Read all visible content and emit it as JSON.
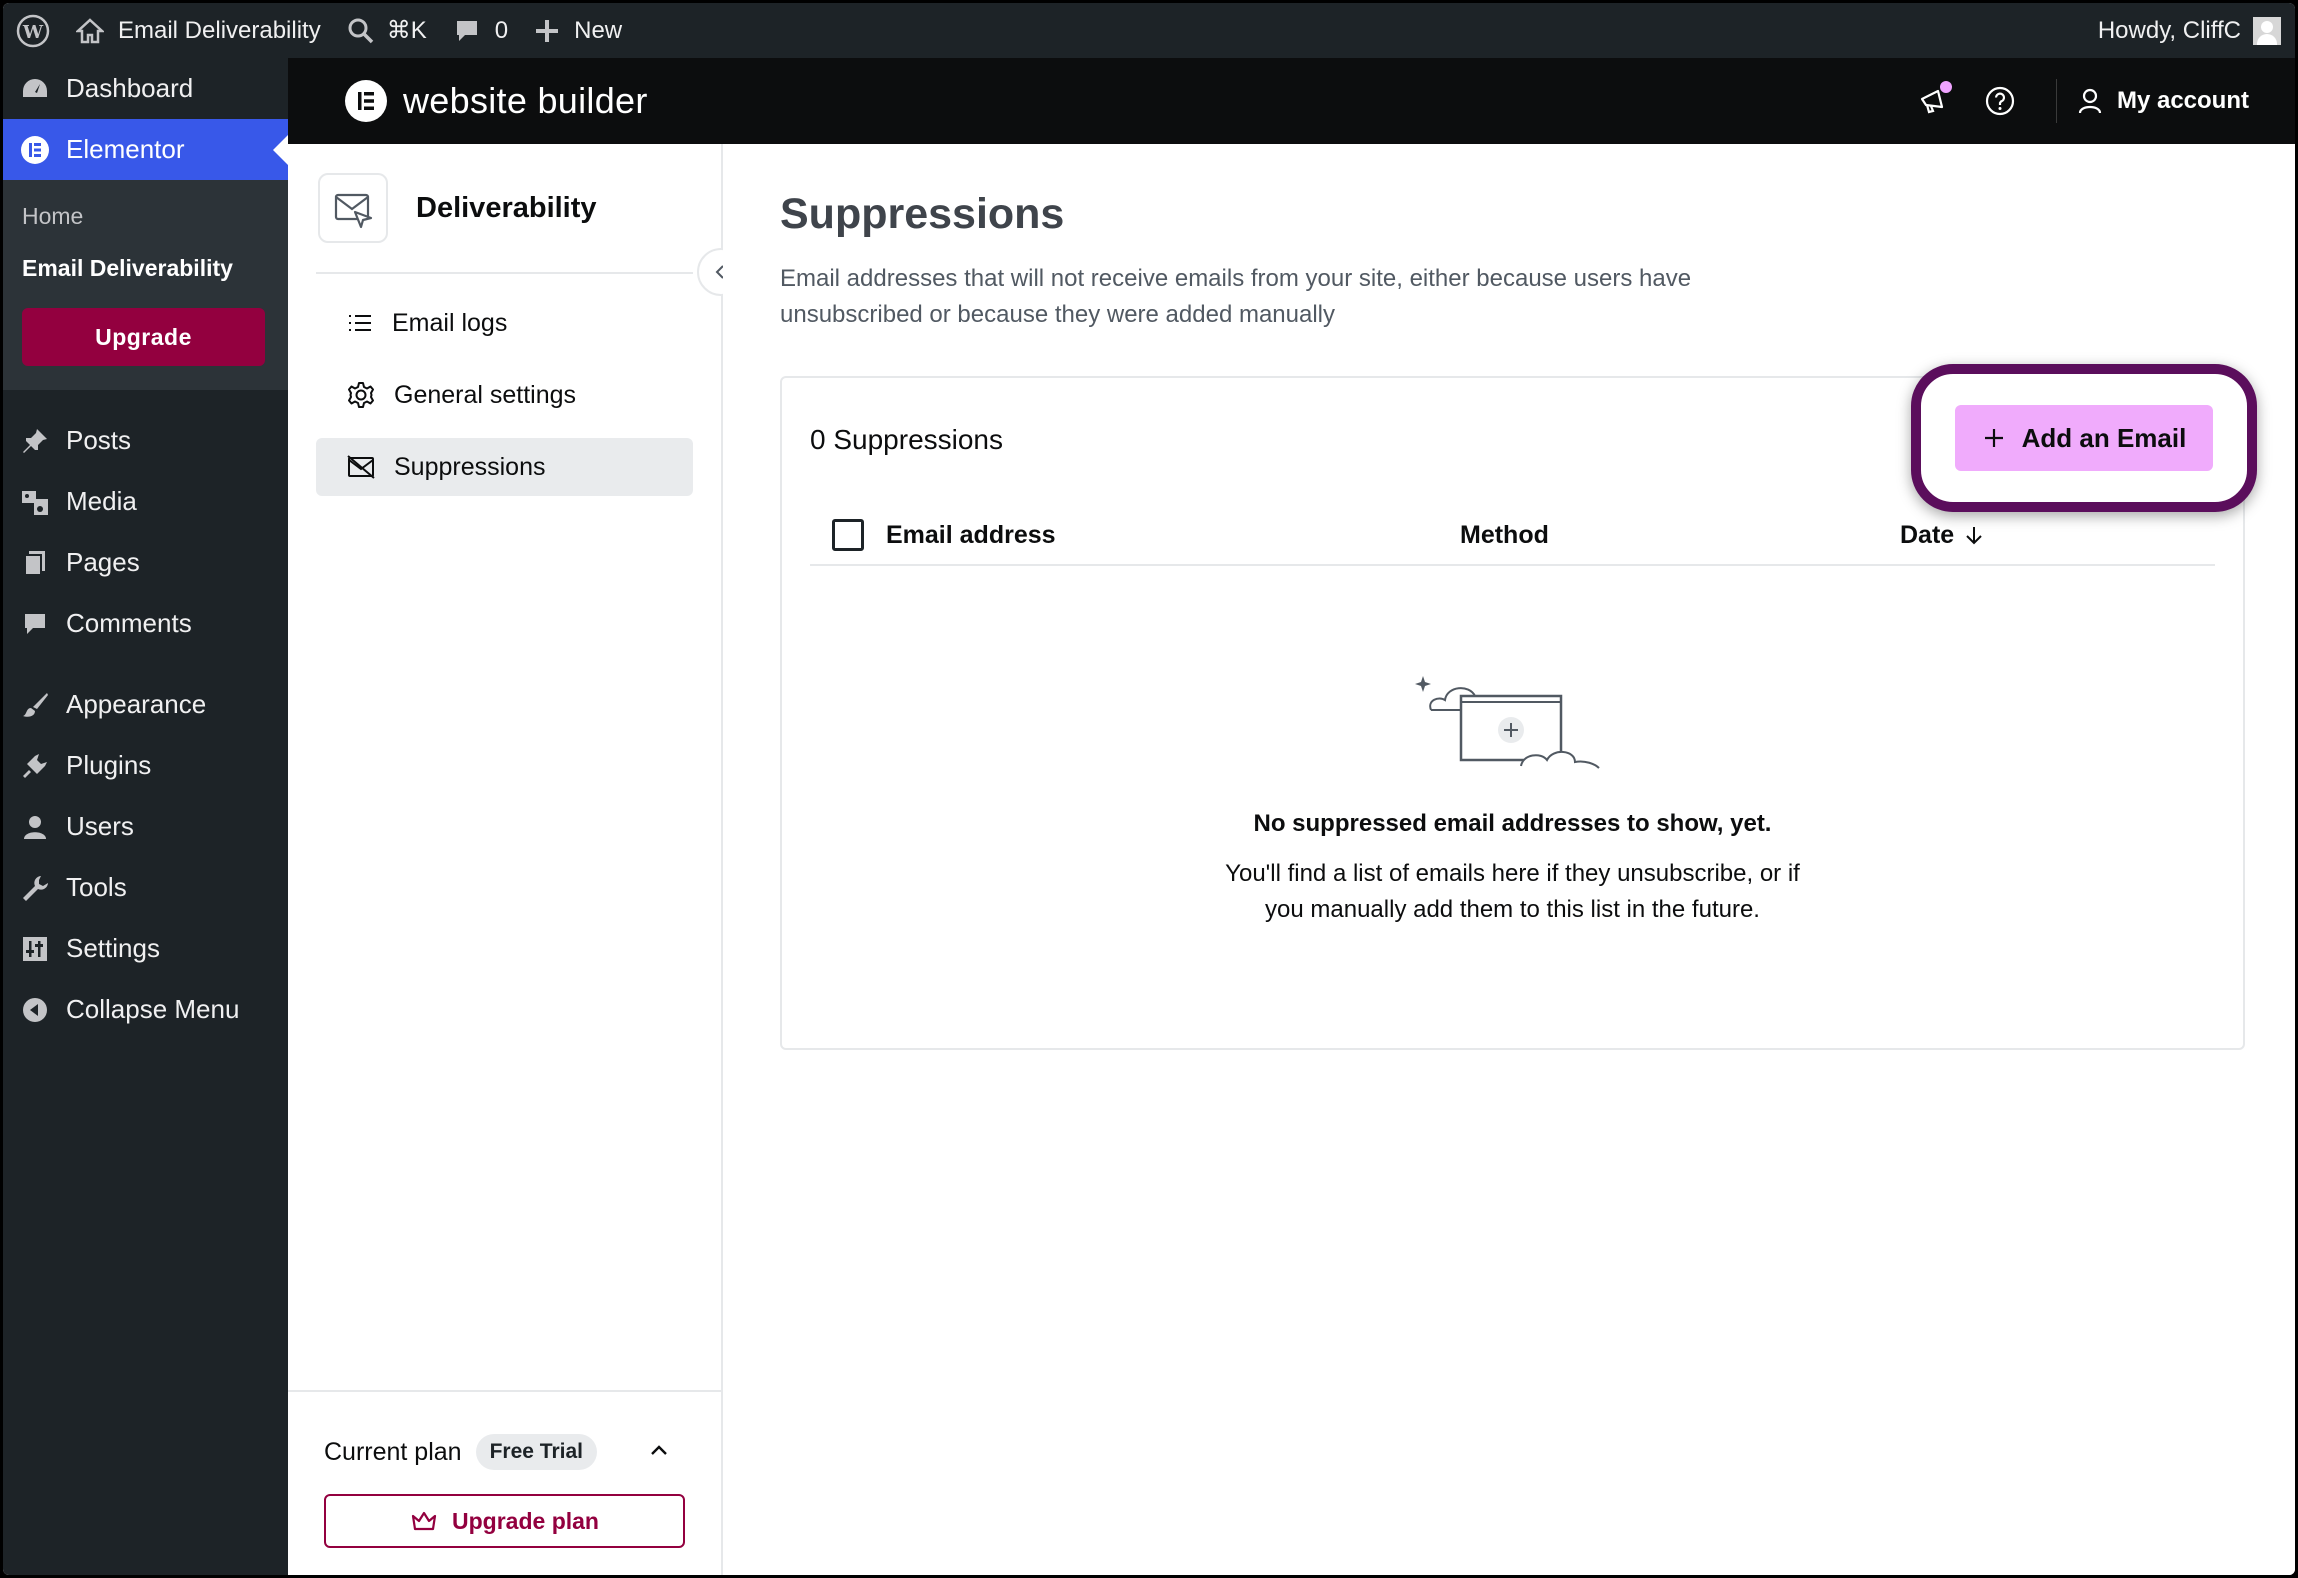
{
  "adminbar": {
    "site_name": "Email Deliverability",
    "search_shortcut": "⌘K",
    "comments_count": "0",
    "new_label": "New",
    "howdy": "Howdy, CliffC"
  },
  "sidebar": {
    "dashboard": "Dashboard",
    "elementor": "Elementor",
    "submenu": {
      "home": "Home",
      "email_deliverability": "Email Deliverability"
    },
    "upgrade": "Upgrade",
    "items": [
      "Posts",
      "Media",
      "Pages",
      "Comments",
      "Appearance",
      "Plugins",
      "Users",
      "Tools",
      "Settings",
      "Collapse Menu"
    ]
  },
  "header": {
    "title": "website builder",
    "account": "My account"
  },
  "panel": {
    "title": "Deliverability",
    "nav": [
      "Email logs",
      "General settings",
      "Suppressions"
    ],
    "plan_label": "Current plan",
    "plan_name": "Free Trial",
    "upgrade_plan": "Upgrade plan"
  },
  "main": {
    "title": "Suppressions",
    "description": "Email addresses that will not receive emails from your site, either because users have unsubscribed or because they were added manually",
    "count": "0 Suppressions",
    "add_button": "Add an Email",
    "columns": {
      "email": "Email address",
      "method": "Method",
      "date": "Date"
    },
    "empty_title": "No suppressed email addresses to show, yet.",
    "empty_text": "You'll find a list of emails here if they unsubscribe, or if you manually add them to this list in the future."
  },
  "colors": {
    "wp_dark": "#1d2327",
    "wp_blue": "#3858e9",
    "brand": "#93003f",
    "highlight": "#5b0e5c",
    "add_button": "#f0abfc"
  }
}
